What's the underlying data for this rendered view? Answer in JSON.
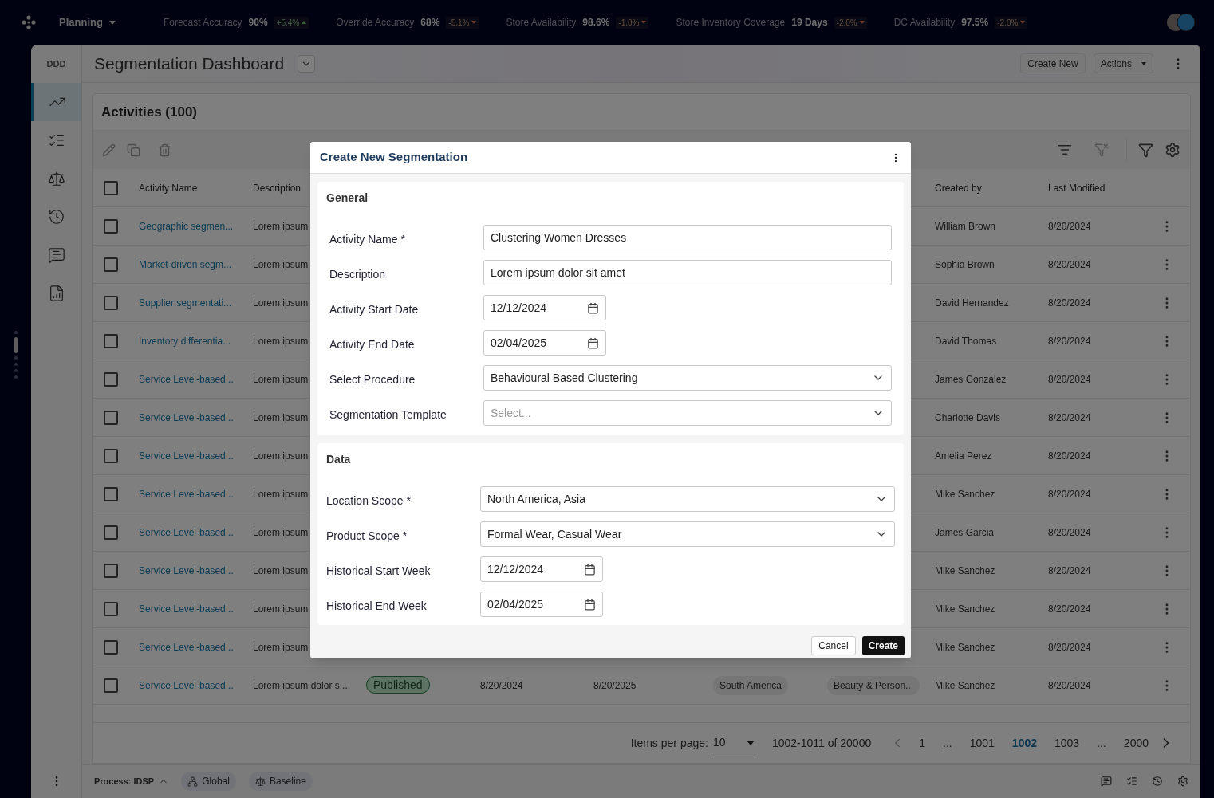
{
  "top_bar": {
    "app_menu": "Planning",
    "metrics": [
      {
        "label": "Forecast Accuracy",
        "value": "90%",
        "delta": "+5.4%",
        "rising": true
      },
      {
        "label": "Override Accuracy",
        "value": "68%",
        "delta": "-5.1%",
        "rising": false
      },
      {
        "label": "Store Availability",
        "value": "98.6%",
        "delta": "-1.8%",
        "rising": false
      },
      {
        "label": "Store Inventory Coverage",
        "value": "19 Days",
        "delta": "-2.0%",
        "rising": false
      },
      {
        "label": "DC Availability",
        "value": "97.5%",
        "delta": "-2.0%",
        "rising": false
      }
    ]
  },
  "sidebar": {
    "logo": "DDD",
    "items": [
      {
        "selected": true
      },
      {
        "selected": false
      },
      {
        "selected": false
      },
      {
        "selected": false
      },
      {
        "selected": false
      },
      {
        "selected": false
      }
    ]
  },
  "header": {
    "title": "Segmentation Dashboard",
    "buttons": [
      "Create New",
      "Actions"
    ]
  },
  "activities": {
    "title": "Activities (100)",
    "select_all_checked": false,
    "columns": [
      "Activity Name",
      "Description",
      "Created by",
      "Last Modified"
    ],
    "rows": [
      {
        "checked": false,
        "name": "Geographic segmen...",
        "description": "Lorem ipsum",
        "created_by": "William Brown",
        "last_modified": "8/20/2024"
      },
      {
        "checked": false,
        "name": "Market-driven segm...",
        "description": "Lorem ipsum",
        "created_by": "Sophia Brown",
        "last_modified": "8/20/2024"
      },
      {
        "checked": false,
        "name": "Supplier segmentati...",
        "description": "Lorem ipsum",
        "created_by": "David Hernandez",
        "last_modified": "8/20/2024"
      },
      {
        "checked": false,
        "name": "Inventory differentia...",
        "description": "Lorem ipsum",
        "created_by": "David Thomas",
        "last_modified": "8/20/2024"
      },
      {
        "name": "Service Level-based...",
        "description": "Lorem ipsum",
        "created_by": "James Gonzalez",
        "checked": false,
        "last_modified": "8/20/2024"
      },
      {
        "name": "Service Level-based...",
        "description": "Lorem ipsum",
        "created_by": "Charlotte Davis",
        "checked": false,
        "last_modified": "8/20/2024"
      },
      {
        "name": "Service Level-based...",
        "description": "Lorem ipsum",
        "created_by": "Amelia Perez",
        "checked": false,
        "last_modified": "8/20/2024"
      },
      {
        "checked": false,
        "name": "Service Level-based...",
        "description": "Lorem ipsum",
        "created_by": "Mike Sanchez",
        "last_modified": "8/20/2024"
      },
      {
        "name": "Service Level-based...",
        "description": "Lorem ipsum",
        "created_by": "James Garcia",
        "checked": false,
        "last_modified": "8/20/2024"
      },
      {
        "checked": false,
        "name": "Service Level-based...",
        "description": "Lorem ipsum",
        "created_by": "Mike Sanchez",
        "last_modified": "8/20/2024"
      },
      {
        "checked": false,
        "name": "Service Level-based...",
        "description": "Lorem ipsum",
        "created_by": "Mike Sanchez",
        "last_modified": "8/20/2024"
      },
      {
        "checked": false,
        "name": "Service Level-based...",
        "description": "Lorem ipsum",
        "created_by": "Mike Sanchez",
        "last_modified": "8/20/2024"
      },
      {
        "name": "Service Level-based...",
        "description": "Lorem ipsum dolor s...",
        "status": "Published",
        "checked": false,
        "start": "8/20/2024",
        "end": "8/20/2025",
        "region": "South America",
        "category": "Beauty & Person...",
        "created_by": "Mike Sanchez",
        "last_modified": "8/20/2024"
      }
    ],
    "pagination": {
      "items_per_page_label": "Items per page:",
      "items_per_page": "10",
      "range": "1002-1011 of 20000",
      "pages": [
        {
          "label": "1",
          "selected": false
        },
        {
          "label": "...",
          "selected": false
        },
        {
          "label": "1001",
          "selected": false
        },
        {
          "label": "1002",
          "selected": true
        },
        {
          "label": "1003",
          "selected": false
        },
        {
          "label": "...",
          "selected": false
        },
        {
          "label": "2000",
          "selected": false
        }
      ]
    }
  },
  "footer": {
    "process": "Process: IDSP",
    "chips": [
      "Global",
      "Baseline"
    ]
  },
  "dialog": {
    "title": "Create New Segmentation",
    "sections": [
      {
        "title": "General",
        "fields": [
          {
            "label": "Activity Name *",
            "kind": "text",
            "value": "Clustering Women Dresses"
          },
          {
            "label": "Description",
            "kind": "text",
            "value": "Lorem ipsum dolor sit amet"
          },
          {
            "label": "Activity Start Date",
            "kind": "date",
            "value": "12/12/2024"
          },
          {
            "label": "Activity End Date",
            "kind": "date",
            "value": "02/04/2025"
          },
          {
            "label": "Select Procedure",
            "kind": "select",
            "value": "Behavioural Based Clustering"
          },
          {
            "label": "Segmentation Template",
            "kind": "select",
            "placeholder": "Select..."
          }
        ]
      },
      {
        "title": "Data",
        "fields": [
          {
            "label": "Location Scope *",
            "kind": "select",
            "value": "North America, Asia"
          },
          {
            "label": "Product Scope *",
            "kind": "select",
            "value": "Formal Wear, Casual Wear"
          },
          {
            "label": "Historical Start Week",
            "kind": "date",
            "value": "12/12/2024"
          },
          {
            "label": "Historical End Week",
            "kind": "date",
            "value": "02/04/2025"
          }
        ]
      }
    ],
    "buttons": [
      {
        "label": "Cancel",
        "kind": "secondary"
      },
      {
        "label": "Create",
        "kind": "primary"
      }
    ]
  }
}
